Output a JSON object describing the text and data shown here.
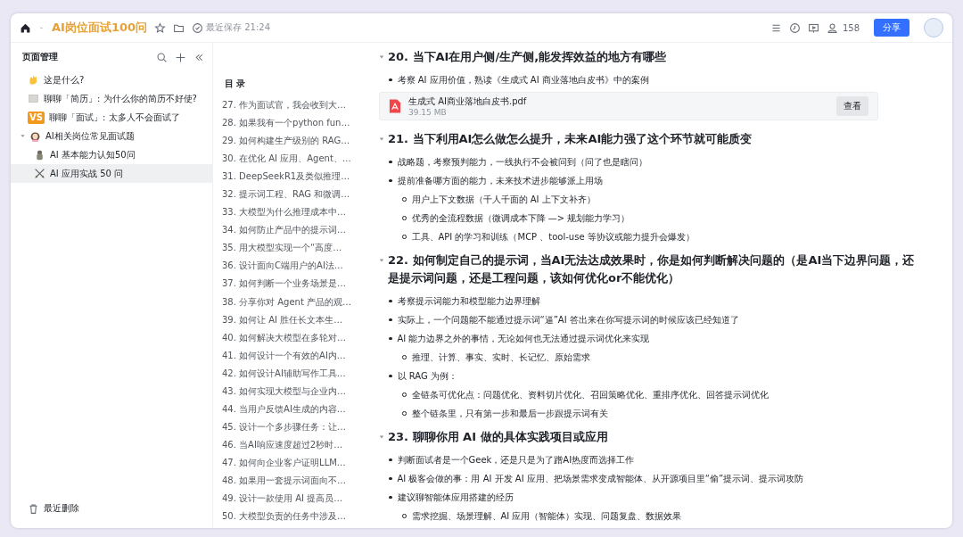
{
  "doc_header": {
    "title": "AI岗位面试100问",
    "starred": false,
    "save_status": "最近保存 21:24",
    "viewers": "158",
    "share_button": "分享"
  },
  "sidebar": {
    "title": "页面管理",
    "items": [
      {
        "label": "这是什么?",
        "selected": false
      },
      {
        "label": "聊聊「简历」: 为什么你的简历不好使?",
        "selected": false
      },
      {
        "label": "聊聊「面试」: 太多人不会面试了",
        "badge": "VS",
        "selected": false
      },
      {
        "label": "AI相关岗位常见面试题",
        "selected": false,
        "expanded": true,
        "children": [
          {
            "label": "AI 基本能力认知50问",
            "selected": false
          },
          {
            "label": "AI 应用实战 50 问",
            "selected": true
          }
        ]
      }
    ],
    "footer": "最近删除"
  },
  "toc": {
    "title": "目 录",
    "items": [
      "27. 作为面试官，我会收到大…",
      "28. 如果我有一个python fun…",
      "29. 如何构建生产级别的 RAG…",
      "30. 在优化 AI 应用、Agent、…",
      "31. DeepSeekR1及类似推理…",
      "32. 提示词工程、RAG 和微调…",
      "33. 大模型为什么推理成本中…",
      "34. 如何防止产品中的提示词…",
      "35. 用大模型实现一个“高度…",
      "36. 设计面向C端用户的AI法…",
      "37. 如何判断一个业务场景是…",
      "38. 分享你对 Agent 产品的观…",
      "39. 如何让 AI 胜任长文本生…",
      "40. 如何解决大模型在多轮对…",
      "41. 如何设计一个有效的AI内…",
      "42. 如何设计AI辅助写作工具…",
      "43. 如何实现大模型与企业内…",
      "44. 当用户反馈AI生成的内容…",
      "45. 设计一个多步骤任务：让…",
      "46. 当AI响应速度超过2秒时…",
      "47. 如何向企业客户证明LLM…",
      "48. 如果用一套提示词面向不…",
      "49. 设计一款使用 AI 提高员…",
      "50. 大模型负责的任务中涉及…"
    ]
  },
  "sections": [
    {
      "heading": "20. 当下AI在用户侧/生产侧,能发挥效益的地方有哪些",
      "expanded": true,
      "blocks": [
        {
          "kind": "bullet",
          "text": "考察 AI 应用价值，熟读《生成式 AI 商业落地白皮书》中的案例"
        },
        {
          "kind": "file",
          "name": "生成式 AI商业落地白皮书.pdf",
          "size": "39.15 MB",
          "button": "查看"
        }
      ]
    },
    {
      "heading": "21. 当下利用AI怎么做怎么提升，未来AI能力强了这个环节就可能质变",
      "expanded": true,
      "blocks": [
        {
          "kind": "bullet",
          "text": "战略题，考察预判能力，一线执行不会被问到（问了也是瞎问）"
        },
        {
          "kind": "bullet",
          "text": "提前准备哪方面的能力，未来技术进步能够派上用场",
          "children": [
            "用户上下文数据（千人千面的 AI 上下文补齐）",
            "优秀的全流程数据（微调成本下降 —> 规划能力学习）",
            "工具、API 的学习和训练（MCP 、tool-use 等协议或能力提升会爆发）"
          ]
        }
      ]
    },
    {
      "heading": "22. 如何制定自己的提示词，当AI无法达成效果时，你是如何判断解决问题的（是AI当下边界问题，还是提示词问题，还是工程问题，该如何优化or不能优化）",
      "expanded": true,
      "blocks": [
        {
          "kind": "bullet",
          "text": "考察提示词能力和模型能力边界理解"
        },
        {
          "kind": "bullet",
          "text": "实际上，一个问题能不能通过提示词“逼”AI 答出来在你写提示词的时候应该已经知道了"
        },
        {
          "kind": "bullet",
          "text": "AI 能力边界之外的事情，无论如何也无法通过提示词优化来实现",
          "children": [
            "推理、计算、事实、实时、长记忆、原始需求"
          ]
        },
        {
          "kind": "bullet",
          "text": "以 RAG 为例：",
          "children": [
            "全链条可优化点：问题优化、资料切片优化、召回策略优化、重排序优化、回答提示词优化",
            "整个链条里，只有第一步和最后一步跟提示词有关"
          ]
        }
      ]
    },
    {
      "heading": "23. 聊聊你用 AI 做的具体实践项目或应用",
      "expanded": true,
      "blocks": [
        {
          "kind": "bullet",
          "text": "判断面试者是一个Geek，还是只是为了蹭AI热度而选择工作"
        },
        {
          "kind": "bullet",
          "text": "AI 极客会做的事：用 AI 开发 AI 应用、把场景需求变成智能体、从开源项目里“偷”提示词、提示词攻防"
        },
        {
          "kind": "bullet",
          "text": "建议聊智能体应用搭建的经历",
          "children": [
            "需求挖掘、场景理解、AI 应用（智能体）实现、问题复盘、数据效果"
          ]
        }
      ]
    }
  ]
}
